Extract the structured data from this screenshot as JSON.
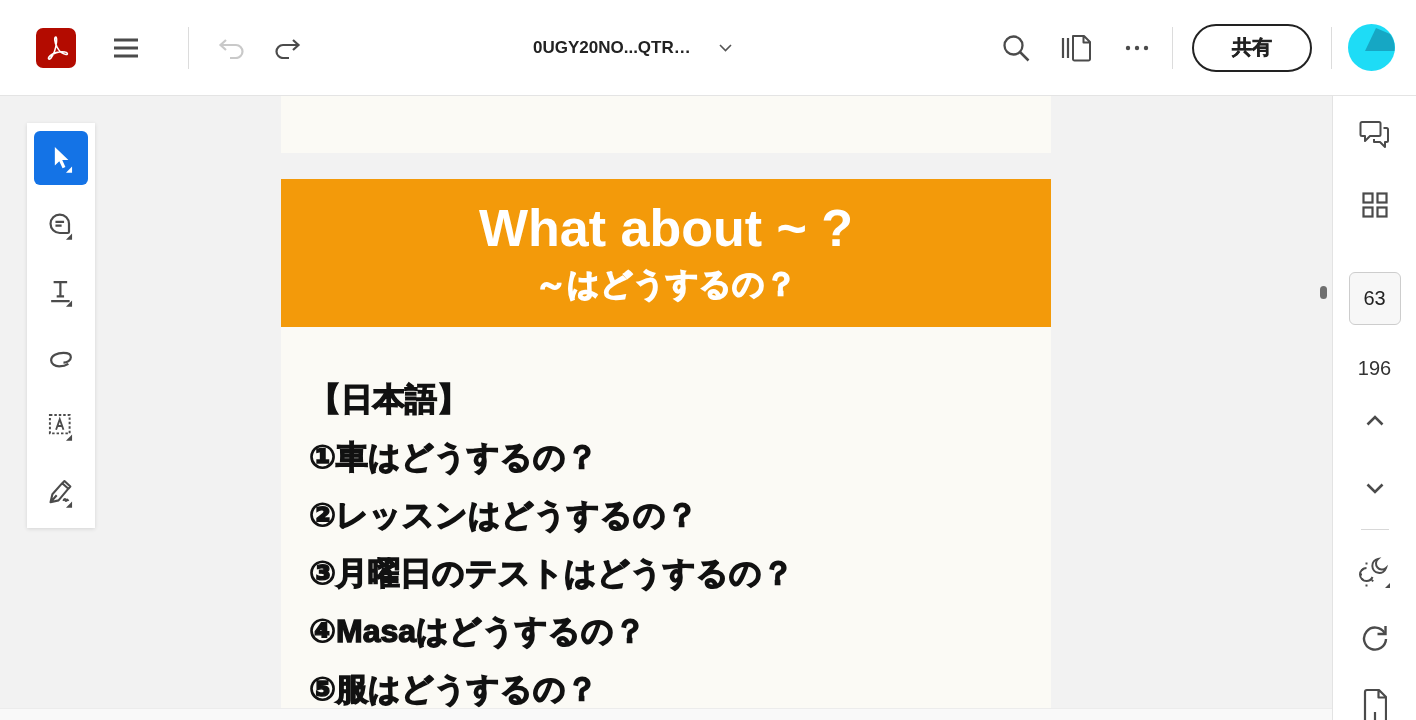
{
  "toolbar": {
    "undo": {
      "disabled": true
    },
    "redo": {
      "disabled": false
    },
    "file_name": "0UGY20NO...QTR…",
    "share_button": "共有"
  },
  "tools": [
    {
      "kind": "select",
      "selected": true
    },
    {
      "kind": "comment",
      "selected": false
    },
    {
      "kind": "text",
      "selected": false
    },
    {
      "kind": "draw",
      "selected": false
    },
    {
      "kind": "text_box",
      "selected": false
    },
    {
      "kind": "sign",
      "selected": false
    }
  ],
  "document": {
    "banner": {
      "title": "What about ~ ?",
      "subtitle": "～はどうするの？"
    },
    "lines": [
      "【日本語】",
      "①車はどうするの？",
      "②レッスンはどうするの？",
      "③月曜日のテストはどうするの？",
      "④Masaはどうするの？",
      "⑤服はどうするの？"
    ]
  },
  "page_nav": {
    "current_page": "63",
    "total_pages": "196"
  }
}
